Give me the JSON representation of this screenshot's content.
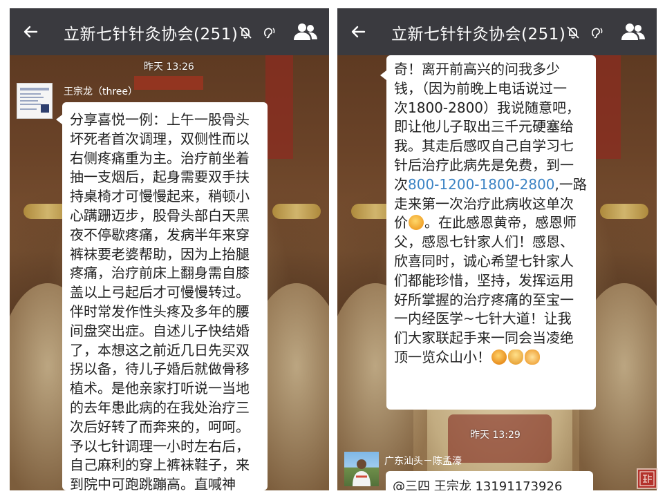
{
  "colors": {
    "title_bar": "#3a3a3f",
    "bubble": "#ffffff",
    "link": "#3b83c4",
    "seal": "#b3322b"
  },
  "left_screen": {
    "title": "立新七针针灸协会(251)",
    "icons": [
      "back-arrow-icon",
      "mute-bell-icon",
      "earpiece-icon",
      "group-members-icon"
    ],
    "timestamp": "昨天 13:26",
    "sender": "王宗龙（three）",
    "message_lines": [
      "分享喜悦一例：上午一股骨头",
      "坏死者首次调理，双侧性而以",
      "右侧疼痛重为主。治疗前坐着",
      "抽一支烟后，起身需要双手扶",
      "持桌椅才可慢慢起来，稍顿小",
      "心蹒跚迈步，股骨头部白天黑",
      "夜不停歇疼痛，发病半年来穿",
      "裤袜要老婆帮助，因为上抬腿",
      "疼痛，治疗前床上翻身需自膝",
      "盖以上弓起后才可慢慢转过。",
      "伴时常发作性头疼及多年的腰",
      "间盘突出症。自述儿子快结婚",
      "了，本想这之前近几日先买双",
      "拐以备，待儿子婚后就做骨移",
      "植术。是他亲家打听说一当地",
      "的去年患此病的在我处治疗三",
      "次后好转了而奔来的，呵呵。",
      "予以七针调理一小时左右后，",
      "自己麻利的穿上裤袜鞋子，来",
      "到院中可跑跳蹦高。直喊神"
    ]
  },
  "right_screen": {
    "title": "立新七针针灸协会(251)",
    "icons": [
      "back-arrow-icon",
      "mute-bell-icon",
      "earpiece-icon",
      "group-members-icon"
    ],
    "message": {
      "l1": "奇！离开前高兴的问我多少",
      "l2": "钱，（因为前晚上电话说过一",
      "l3": "次1800-2800）我说随意吧，",
      "l4": "即让他儿子取出三千元硬塞给",
      "l5": "我。其走后感叹自己自学习七",
      "l6": "针后治疗此病先是免费，到一",
      "l7_prefix": "次",
      "l7_number": "800-1200-1800-2800",
      "l7_suffix": ",一路",
      "l8": "走来第一次治疗此病收这单次",
      "l9_prefix": "价",
      "l9_suffix": "。在此感恩黄帝，感恩师",
      "l10": "父，感恩七针家人们！感恩、",
      "l11": "欣喜同时，诚心希望七针家人",
      "l12": "们都能珍惜，坚持，发挥运用",
      "l13": "好所掌握的治疗疼痛的至宝一",
      "l14": "一内经医学~七针大道！让我",
      "l15": "们大家联起手来一同会当凌绝",
      "l16": "顶一览众山小！"
    },
    "emojis": [
      "fist-emoji",
      "fist-emoji",
      "bow-emoji",
      "handshake-emoji"
    ],
    "timestamp": "昨天 13:29",
    "next_sender": "广东汕头－陈孟濠",
    "next_message_preview": "@三四 王宗龙 13191173926"
  }
}
